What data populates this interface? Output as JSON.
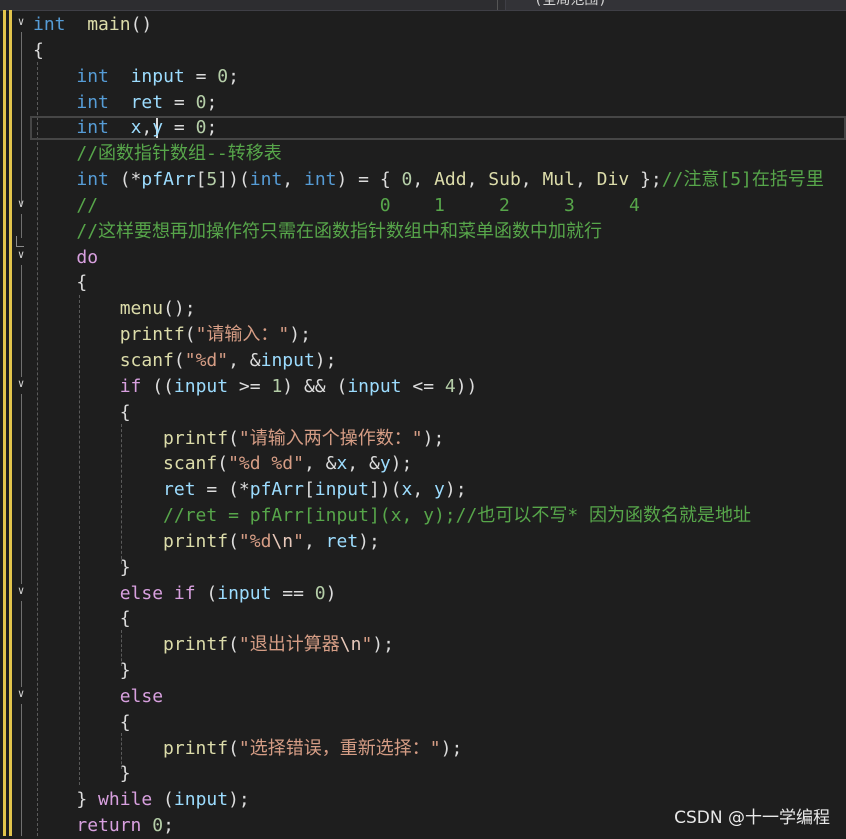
{
  "editor": {
    "scope_label": "(全局范围)",
    "lines": [
      [
        [
          "kw",
          "int"
        ],
        [
          "",
          "  "
        ],
        [
          "fn",
          "main"
        ],
        [
          "",
          "()"
        ]
      ],
      [
        [
          "",
          "{"
        ]
      ],
      [
        [
          "",
          "    "
        ],
        [
          "kw",
          "int"
        ],
        [
          "",
          "  "
        ],
        [
          "var",
          "input"
        ],
        [
          "",
          " = "
        ],
        [
          "num",
          "0"
        ],
        [
          "",
          ";"
        ]
      ],
      [
        [
          "",
          "    "
        ],
        [
          "kw",
          "int"
        ],
        [
          "",
          "  "
        ],
        [
          "var",
          "ret"
        ],
        [
          "",
          " = "
        ],
        [
          "num",
          "0"
        ],
        [
          "",
          ";"
        ]
      ],
      [
        [
          "",
          "    "
        ],
        [
          "kw",
          "int"
        ],
        [
          "",
          "  "
        ],
        [
          "var",
          "x"
        ],
        [
          "",
          ","
        ],
        [
          "var",
          "y"
        ],
        [
          "",
          " = "
        ],
        [
          "num",
          "0"
        ],
        [
          "",
          ";"
        ]
      ],
      [
        [
          "",
          "    "
        ],
        [
          "cmt",
          "//函数指针数组--转移表"
        ]
      ],
      [
        [
          "",
          "    "
        ],
        [
          "kw",
          "int"
        ],
        [
          "",
          " (*"
        ],
        [
          "var",
          "pfArr"
        ],
        [
          "",
          "["
        ],
        [
          "num",
          "5"
        ],
        [
          "",
          "])("
        ],
        [
          "kw",
          "int"
        ],
        [
          "",
          ", "
        ],
        [
          "kw",
          "int"
        ],
        [
          "",
          ") = { "
        ],
        [
          "num",
          "0"
        ],
        [
          "",
          ", "
        ],
        [
          "fn",
          "Add"
        ],
        [
          "",
          ", "
        ],
        [
          "fn",
          "Sub"
        ],
        [
          "",
          ", "
        ],
        [
          "fn",
          "Mul"
        ],
        [
          "",
          ", "
        ],
        [
          "fn",
          "Div"
        ],
        [
          "",
          " };"
        ],
        [
          "cmt",
          "//注意[5]在括号里"
        ]
      ],
      [
        [
          "",
          "    "
        ],
        [
          "cmt",
          "//                          0    1     2     3     4"
        ]
      ],
      [
        [
          "",
          "    "
        ],
        [
          "cmt",
          "//这样要想再加操作符只需在函数指针数组中和菜单函数中加就行"
        ]
      ],
      [
        [
          "",
          "    "
        ],
        [
          "ctl",
          "do"
        ]
      ],
      [
        [
          "",
          "    {"
        ]
      ],
      [
        [
          "",
          "        "
        ],
        [
          "fn",
          "menu"
        ],
        [
          "",
          "();"
        ]
      ],
      [
        [
          "",
          "        "
        ],
        [
          "fn",
          "printf"
        ],
        [
          "",
          "("
        ],
        [
          "str",
          "\"请输入：\""
        ],
        [
          "",
          ");"
        ]
      ],
      [
        [
          "",
          "        "
        ],
        [
          "fn",
          "scanf"
        ],
        [
          "",
          "("
        ],
        [
          "str",
          "\"%d\""
        ],
        [
          "",
          ", &"
        ],
        [
          "var",
          "input"
        ],
        [
          "",
          ");"
        ]
      ],
      [
        [
          "",
          "        "
        ],
        [
          "ctl",
          "if"
        ],
        [
          "",
          " (("
        ],
        [
          "var",
          "input"
        ],
        [
          "",
          " >= "
        ],
        [
          "num",
          "1"
        ],
        [
          "",
          ") && ("
        ],
        [
          "var",
          "input"
        ],
        [
          "",
          " <= "
        ],
        [
          "num",
          "4"
        ],
        [
          "",
          "))"
        ]
      ],
      [
        [
          "",
          "        {"
        ]
      ],
      [
        [
          "",
          "            "
        ],
        [
          "fn",
          "printf"
        ],
        [
          "",
          "("
        ],
        [
          "str",
          "\"请输入两个操作数：\""
        ],
        [
          "",
          ");"
        ]
      ],
      [
        [
          "",
          "            "
        ],
        [
          "fn",
          "scanf"
        ],
        [
          "",
          "("
        ],
        [
          "str",
          "\"%d %d\""
        ],
        [
          "",
          ", &"
        ],
        [
          "var",
          "x"
        ],
        [
          "",
          ", &"
        ],
        [
          "var",
          "y"
        ],
        [
          "",
          ");"
        ]
      ],
      [
        [
          "",
          "            "
        ],
        [
          "var",
          "ret"
        ],
        [
          "",
          " = (*"
        ],
        [
          "var",
          "pfArr"
        ],
        [
          "",
          "["
        ],
        [
          "var",
          "input"
        ],
        [
          "",
          "])("
        ],
        [
          "var",
          "x"
        ],
        [
          "",
          ", "
        ],
        [
          "var",
          "y"
        ],
        [
          "",
          ");"
        ]
      ],
      [
        [
          "",
          "            "
        ],
        [
          "cmt",
          "//ret = pfArr[input](x, y);//也可以不写* 因为函数名就是地址"
        ]
      ],
      [
        [
          "",
          "            "
        ],
        [
          "fn",
          "printf"
        ],
        [
          "",
          "("
        ],
        [
          "str",
          "\"%d"
        ],
        [
          "esc",
          "\\n"
        ],
        [
          "str",
          "\""
        ],
        [
          "",
          ", "
        ],
        [
          "var",
          "ret"
        ],
        [
          "",
          ");"
        ]
      ],
      [
        [
          "",
          "        }"
        ]
      ],
      [
        [
          "",
          "        "
        ],
        [
          "ctl",
          "else if"
        ],
        [
          "",
          " ("
        ],
        [
          "var",
          "input"
        ],
        [
          "",
          " == "
        ],
        [
          "num",
          "0"
        ],
        [
          "",
          ")"
        ]
      ],
      [
        [
          "",
          "        {"
        ]
      ],
      [
        [
          "",
          "            "
        ],
        [
          "fn",
          "printf"
        ],
        [
          "",
          "("
        ],
        [
          "str",
          "\"退出计算器"
        ],
        [
          "esc",
          "\\n"
        ],
        [
          "str",
          "\""
        ],
        [
          "",
          ");"
        ]
      ],
      [
        [
          "",
          "        }"
        ]
      ],
      [
        [
          "",
          "        "
        ],
        [
          "ctl",
          "else"
        ]
      ],
      [
        [
          "",
          "        {"
        ]
      ],
      [
        [
          "",
          "            "
        ],
        [
          "fn",
          "printf"
        ],
        [
          "",
          "("
        ],
        [
          "str",
          "\"选择错误，重新选择：\""
        ],
        [
          "",
          ");"
        ]
      ],
      [
        [
          "",
          "        }"
        ]
      ],
      [
        [
          "",
          "    } "
        ],
        [
          "ctl",
          "while"
        ],
        [
          "",
          " ("
        ],
        [
          "var",
          "input"
        ],
        [
          "",
          ");"
        ]
      ],
      [
        [
          "",
          "    "
        ],
        [
          "ctl",
          "return"
        ],
        [
          "",
          " "
        ],
        [
          "num",
          "0"
        ],
        [
          "",
          ";"
        ]
      ]
    ]
  },
  "watermark": "CSDN @十一学编程",
  "colors": {
    "background": "#1e1e1e",
    "keyword": "#569cd6",
    "control": "#d8a0df",
    "function": "#dcdcaa",
    "variable": "#9cdcfe",
    "number": "#b5cea8",
    "string": "#d69d85",
    "comment": "#57a64a",
    "change_bar": "#e2c44c"
  },
  "icons": [
    "collapse-chevron-icon",
    "fold-end-marker"
  ]
}
